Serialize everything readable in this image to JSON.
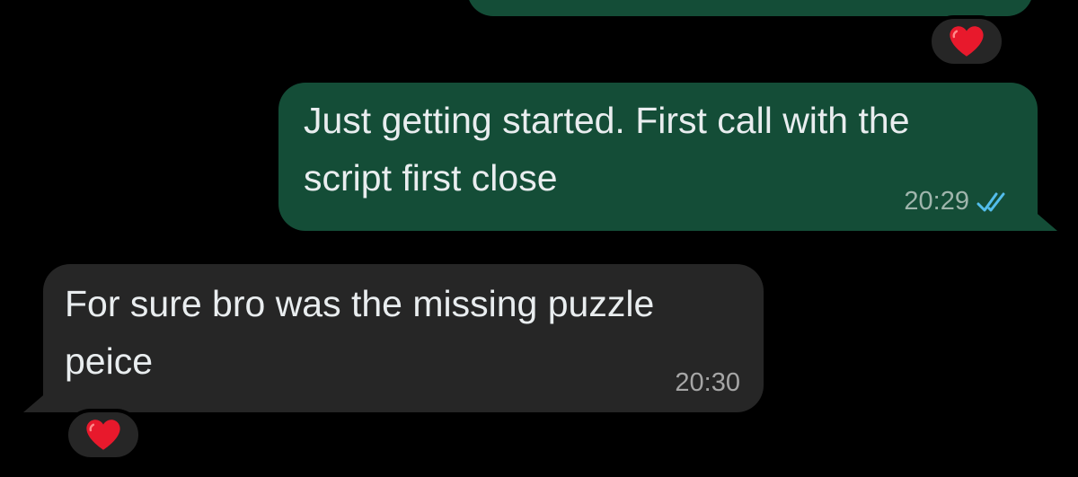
{
  "messages": [
    {
      "direction": "outgoing",
      "text": "Just getting started. First call with the\nscript first close",
      "time": "20:29",
      "status_icon": "double-check-icon",
      "status_color": "#53bdeb"
    },
    {
      "direction": "incoming",
      "text": "For sure bro was the missing puzzle\npeice",
      "time": "20:30"
    }
  ],
  "reactions": {
    "top_message": "heart",
    "incoming_message": "heart"
  },
  "colors": {
    "background": "#000000",
    "outgoing_bubble": "#144d37",
    "incoming_bubble": "#262626",
    "text": "#e9edef",
    "heart": "#e8192c"
  }
}
